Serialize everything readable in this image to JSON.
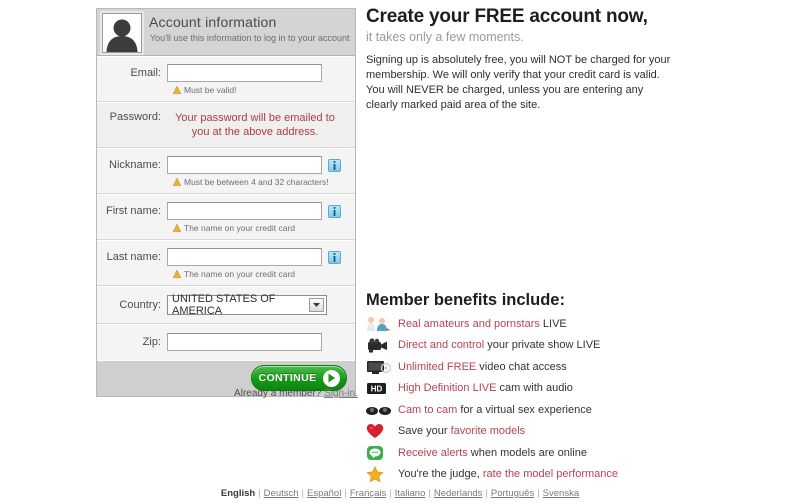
{
  "panel": {
    "title": "Account information",
    "subtitle": "You'll use this information to log in to your account",
    "avatar_icon": "user-silhouette-icon",
    "fields": [
      {
        "label": "Email:",
        "value": "",
        "placeholder": "",
        "hint": "Must be valid!",
        "hint_icon": "warning-icon",
        "has_info": false
      },
      {
        "label": "Nickname:",
        "value": "",
        "placeholder": "",
        "hint": "Must be between 4 and 32 characters!",
        "hint_icon": "warning-icon",
        "has_info": true,
        "info_icon": "info-icon"
      },
      {
        "label": "First name:",
        "value": "",
        "placeholder": "",
        "hint": "The name on your credit card",
        "hint_icon": "warning-icon",
        "has_info": true,
        "info_icon": "info-icon"
      },
      {
        "label": "Last name:",
        "value": "",
        "placeholder": "",
        "hint": "The name on your credit card",
        "hint_icon": "warning-icon",
        "has_info": true,
        "info_icon": "info-icon"
      }
    ],
    "password": {
      "label": "Password:",
      "note": "Your password will be emailed to you at the above address."
    },
    "country": {
      "label": "Country:",
      "selected": "UNITED STATES OF AMERICA",
      "arrow_icon": "chevron-down-icon"
    },
    "zip": {
      "label": "Zip:",
      "value": "",
      "placeholder": ""
    },
    "continue": {
      "label": "CONTINUE",
      "icon": "play-arrow-icon"
    }
  },
  "member_line": {
    "text": "Already a member?",
    "link": "Sign-in."
  },
  "right": {
    "headline": "Create your FREE account now,",
    "subheadline": "it takes only a few moments.",
    "blurb": "Signing up is absolutely free, you will NOT be charged for your membership. We will only verify that your credit card is valid. You will NEVER be charged, unless you are entering any clearly marked paid area of the site."
  },
  "benefits": {
    "title": "Member benefits include:",
    "items": [
      {
        "icon": "two-people-icon",
        "red": "Real amateurs and pornstars",
        "dark": " LIVE"
      },
      {
        "icon": "camcorder-icon",
        "red": "Direct and control",
        "dark": " your private show LIVE"
      },
      {
        "icon": "monitor-icon",
        "red": "Unlimited FREE",
        "dark": " video chat access"
      },
      {
        "icon": "hd-badge-icon",
        "red": "High Definition LIVE",
        "dark": " cam with audio"
      },
      {
        "icon": "two-webcams-icon",
        "red": "Cam to cam",
        "dark": " for a virtual sex experience"
      },
      {
        "icon": "heart-icon",
        "dark": "Save your ",
        "red": "favorite models",
        "order": "dark-first"
      },
      {
        "icon": "chat-bubble-icon",
        "red": "Receive alerts",
        "dark": " when models are online"
      },
      {
        "icon": "star-icon",
        "dark": "You're the judge, ",
        "red": "rate the model performance",
        "order": "dark-first"
      }
    ]
  },
  "footer": {
    "languages": [
      {
        "label": "English",
        "current": true
      },
      {
        "label": "Deutsch",
        "current": false
      },
      {
        "label": "Español",
        "current": false
      },
      {
        "label": "Français",
        "current": false
      },
      {
        "label": "Italiano",
        "current": false
      },
      {
        "label": "Nederlands",
        "current": false
      },
      {
        "label": "Português",
        "current": false
      },
      {
        "label": "Svenska",
        "current": false
      }
    ],
    "separator": "|"
  },
  "colors": {
    "accent_red": "#b8434f",
    "password_note": "#b03a48",
    "continue_green": "#159a15",
    "panel_header": "#d4d4d4",
    "panel_body": "#f4f4f4"
  }
}
